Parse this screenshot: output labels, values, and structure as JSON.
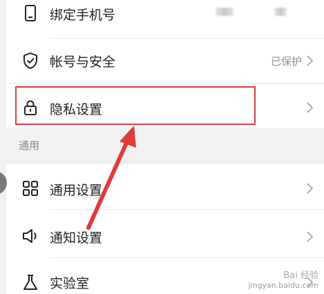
{
  "settings": {
    "bind_phone": {
      "label": "绑定手机号",
      "icon": "phone-icon"
    },
    "account_security": {
      "label": "帐号与安全",
      "value": "已保护",
      "icon": "shield-icon"
    },
    "privacy": {
      "label": "隐私设置",
      "icon": "lock-icon"
    },
    "general_section": "通用",
    "general": {
      "label": "通用设置",
      "icon": "grid-icon"
    },
    "notifications": {
      "label": "通知设置",
      "icon": "speaker-icon"
    },
    "lab": {
      "label": "实验室",
      "icon": "flask-icon"
    }
  },
  "colors": {
    "highlight": "#e03b3b",
    "arrow": "#e03b3b",
    "label": "#222222",
    "muted": "#8e8e8e"
  },
  "watermark": {
    "brand": "Bai 经验",
    "url": "jingyan.baidu.com"
  }
}
